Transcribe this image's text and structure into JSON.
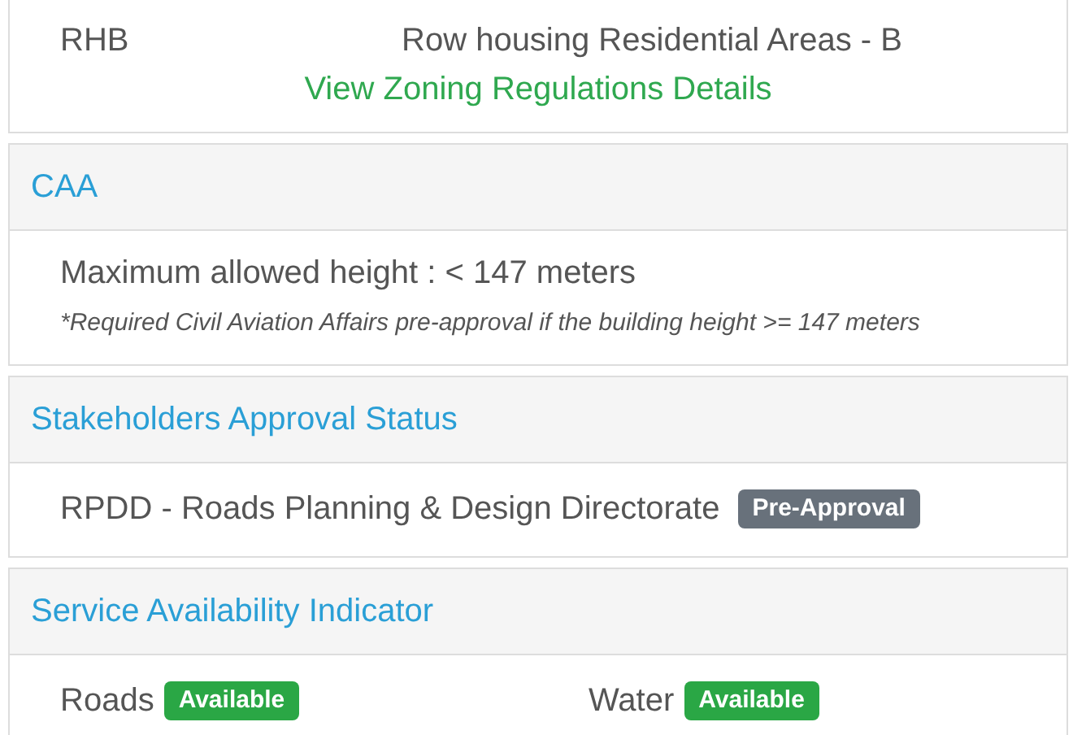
{
  "zoning": {
    "code": "RHB",
    "description": "Row housing Residential Areas - B",
    "link": "View Zoning Regulations Details"
  },
  "caa": {
    "heading": "CAA",
    "max_height": "Maximum allowed height : < 147 meters",
    "note": "*Required Civil Aviation Affairs pre-approval if the building height >= 147 meters"
  },
  "stakeholders": {
    "heading": "Stakeholders Approval Status",
    "items": [
      {
        "name": "RPDD - Roads Planning & Design Directorate",
        "status": "Pre-Approval",
        "kind": "pending"
      }
    ]
  },
  "services": {
    "heading": "Service Availability Indicator",
    "items": [
      {
        "name": "Roads",
        "status": "Available",
        "kind": "available"
      },
      {
        "name": "Water",
        "status": "Available",
        "kind": "available"
      }
    ]
  }
}
